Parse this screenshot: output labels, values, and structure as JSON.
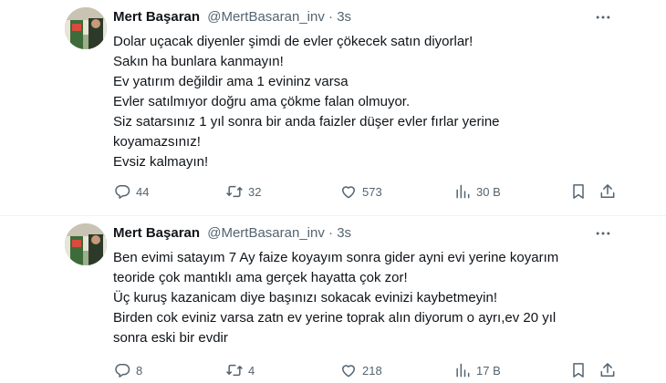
{
  "colors": {
    "text": "#0f1419",
    "secondary": "#536471",
    "divider": "#eff3f4"
  },
  "tweets": [
    {
      "author_name": "Mert Başaran",
      "handle": "@MertBasaran_inv",
      "separator": "·",
      "time": "3s",
      "lines": [
        "Dolar uçacak diyenler şimdi de evler çökecek satın diyorlar!",
        "Sakın ha bunlara kanmayın!",
        "Ev yatırım değildir ama 1 evininz varsa",
        "Evler satılmıyor doğru ama çökme falan olmuyor.",
        "Siz satarsınız 1 yıl sonra bir anda faizler düşer evler fırlar yerine",
        "koyamazsınız!",
        "Evsiz kalmayın!"
      ],
      "replies": "44",
      "retweets": "32",
      "likes": "573",
      "views": "30 B"
    },
    {
      "author_name": "Mert Başaran",
      "handle": "@MertBasaran_inv",
      "separator": "·",
      "time": "3s",
      "lines": [
        "Ben evimi satayım 7 Ay faize koyayım sonra gider ayni evi yerine koyarım",
        "teoride çok mantıklı ama gerçek hayatta çok zor!",
        "Üç kuruş kazanicam diye başınızı sokacak evinizi kaybetmeyin!",
        "Birden cok eviniz varsa zatn ev yerine toprak alın diyorum o ayrı,ev 20 yıl",
        "sonra eski bir evdir"
      ],
      "replies": "8",
      "retweets": "4",
      "likes": "218",
      "views": "17 B"
    }
  ],
  "icons": {
    "more": "more-horizontal-icon",
    "reply": "reply-icon",
    "retweet": "retweet-icon",
    "like": "heart-icon",
    "views": "views-chart-icon",
    "bookmark": "bookmark-icon",
    "share": "share-icon"
  }
}
